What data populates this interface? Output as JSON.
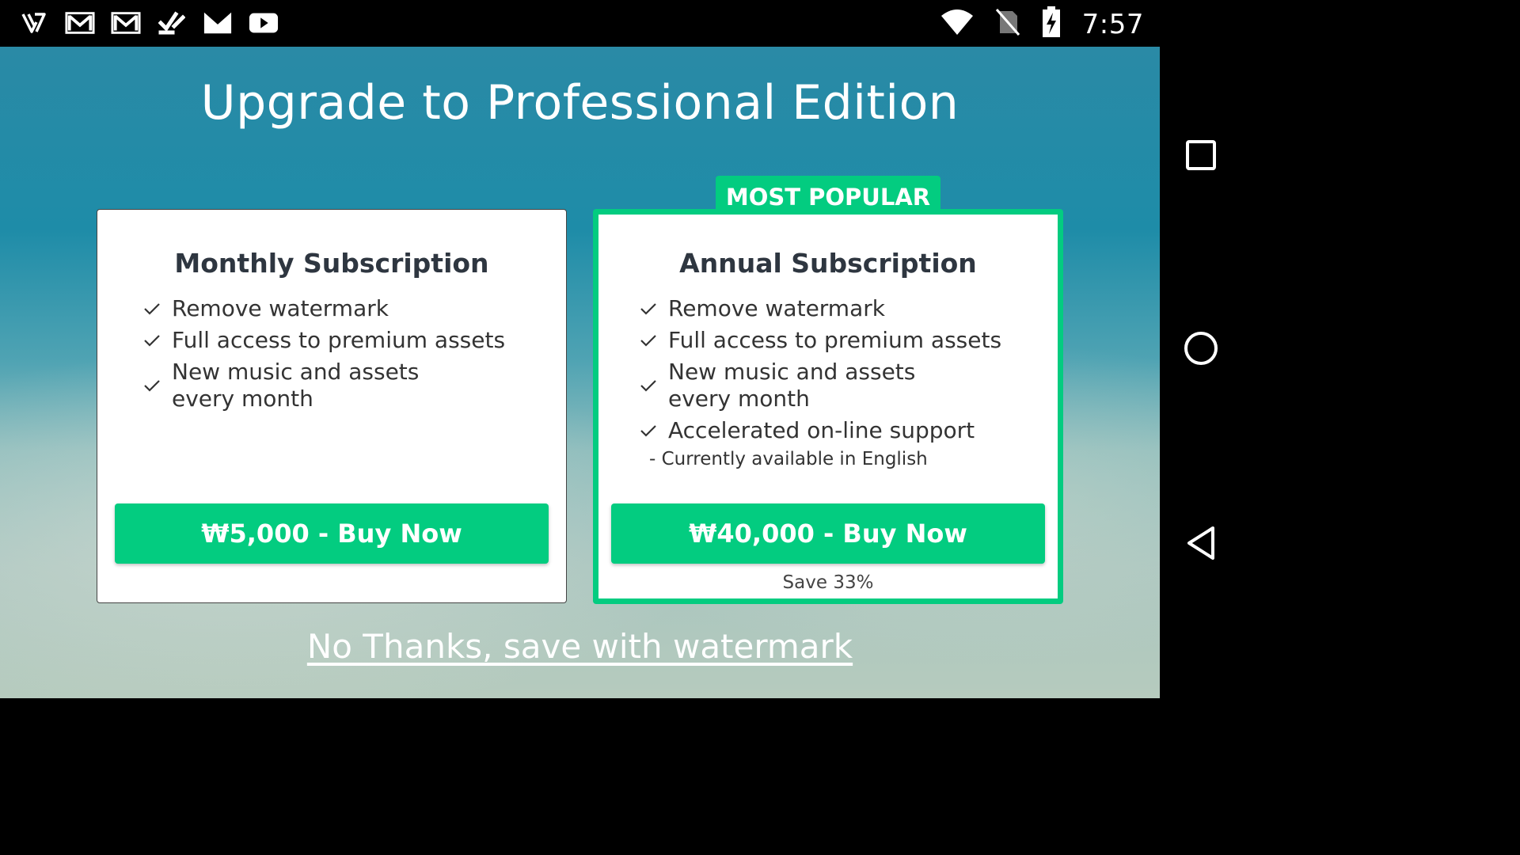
{
  "status_bar": {
    "time": "7:57",
    "left_icons": [
      "v-app-icon",
      "gmail-icon",
      "gmail-icon",
      "tasks-check-icon",
      "gmail-icon",
      "youtube-icon"
    ],
    "right_icons": [
      "wifi-icon",
      "no-sim-icon",
      "battery-charging-icon"
    ]
  },
  "page": {
    "title": "Upgrade to Professional Edition",
    "no_thanks_label": "No Thanks, save with watermark"
  },
  "monthly": {
    "title": "Monthly Subscription",
    "features": [
      "Remove watermark",
      "Full access to premium assets",
      "New music and assets every month"
    ],
    "buy_label": "₩5,000 - Buy Now"
  },
  "annual": {
    "badge": "MOST POPULAR",
    "title": "Annual Subscription",
    "features": [
      "Remove watermark",
      "Full access to premium assets",
      "New music and assets every month",
      "Accelerated on-line support"
    ],
    "support_note": "- Currently available in English",
    "buy_label": "₩40,000 - Buy Now",
    "save_note": "Save 33%"
  },
  "nav_bar": {
    "buttons": [
      "recents-square-icon",
      "home-circle-icon",
      "back-triangle-icon"
    ]
  },
  "colors": {
    "accent_green": "#03cc80",
    "title_text": "#2e3640"
  }
}
